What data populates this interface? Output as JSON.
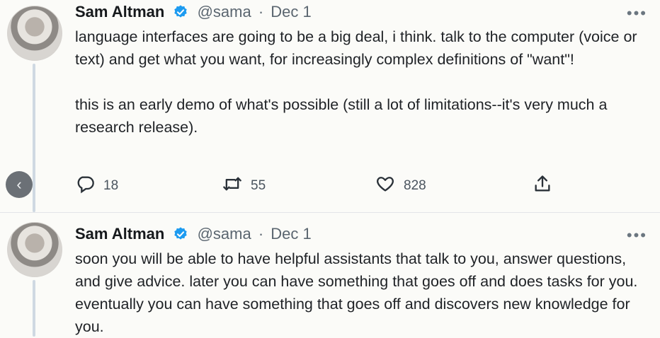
{
  "tweets": [
    {
      "author": "Sam Altman",
      "handle": "@sama",
      "separator": "·",
      "date": "Dec 1",
      "more_label": "•••",
      "paragraphs": [
        "language interfaces are going to be a big deal, i think. talk to the computer (voice or text) and get what you want, for increasingly complex definitions of \"want\"!",
        "this is an early demo of what's possible (still a lot of limitations--it's very much a research release)."
      ],
      "stats": {
        "replies": "18",
        "retweets": "55",
        "likes": "828"
      }
    },
    {
      "author": "Sam Altman",
      "handle": "@sama",
      "separator": "·",
      "date": "Dec 1",
      "more_label": "•••",
      "paragraphs": [
        "soon you will be able to have helpful assistants that talk to you, answer questions, and give advice. later you can have something that goes off and does tasks for you. eventually you can have something that goes off and discovers new knowledge for you."
      ]
    }
  ],
  "nav": {
    "back_glyph": "‹"
  },
  "icons": {
    "verified": "verified-badge-icon",
    "reply": "reply-icon",
    "retweet": "retweet-icon",
    "like": "heart-icon",
    "share": "share-icon"
  },
  "colors": {
    "verified": "#1d9bf0",
    "thread_line": "#cfd9e2",
    "muted": "#5b6670"
  }
}
